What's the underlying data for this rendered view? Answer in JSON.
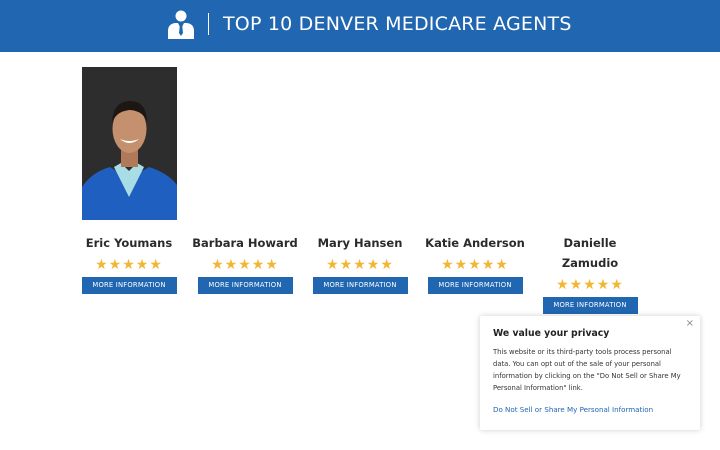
{
  "header": {
    "icon": "agent-person-icon",
    "title": "TOP 10 DENVER MEDICARE AGENTS"
  },
  "colors": {
    "brand": "#2166b0",
    "star": "#f2b632"
  },
  "agents": [
    {
      "name": "Eric Youmans",
      "stars": "★★★★★",
      "rating": 5,
      "button": "MORE INFORMATION"
    },
    {
      "name": "Barbara Howard",
      "stars": "★★★★★",
      "rating": 5,
      "button": "MORE INFORMATION"
    },
    {
      "name": "Mary Hansen",
      "stars": "★★★★★",
      "rating": 5,
      "button": "MORE INFORMATION"
    },
    {
      "name": "Katie Anderson",
      "stars": "★★★★★",
      "rating": 5,
      "button": "MORE INFORMATION"
    },
    {
      "name": "Danielle Zamudio",
      "stars": "★★★★★",
      "rating": 5,
      "button": "MORE INFORMATION"
    }
  ],
  "privacy": {
    "title": "We value your privacy",
    "text": "This website or its third-party tools process personal data. You can opt out of the sale of your personal information by clicking on the \"Do Not Sell or Share My Personal Information\" link.",
    "link": "Do Not Sell or Share My Personal Information",
    "close": "×"
  }
}
